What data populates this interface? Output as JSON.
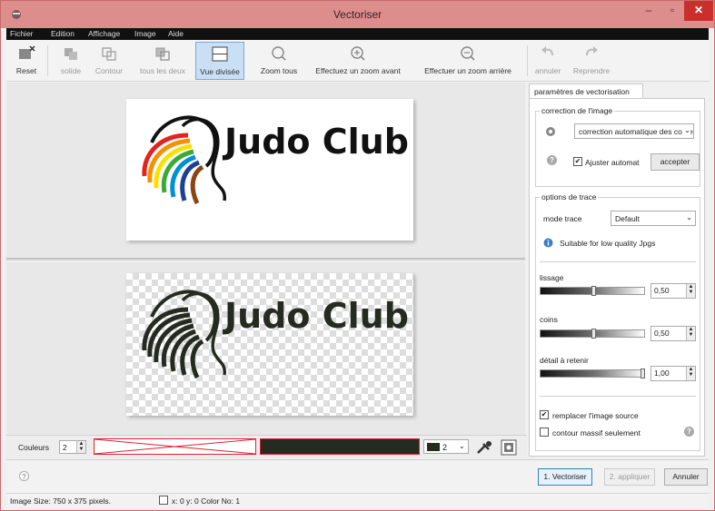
{
  "window": {
    "title": "Vectoriser",
    "min": "–",
    "max": "▫",
    "close": "✕"
  },
  "menu": [
    "Fichier",
    "Edition",
    "Affichage",
    "Image",
    "Aide"
  ],
  "toolbar": {
    "reset": "Reset",
    "solide": "solide",
    "contour": "Contour",
    "tous_les_deux": "tous les deux",
    "vue_divisee": "Vue divisée",
    "zoom_tous": "Zoom tous",
    "zoom_avant": "Effectuez un zoom avant",
    "zoom_arriere": "Effectuer un zoom arrière",
    "annuler": "annuler",
    "reprendre": "Reprendre"
  },
  "canvas": {
    "logo_text": "Judo Club"
  },
  "colorbar": {
    "label": "Couleurs",
    "count": "2",
    "palette_value": "2"
  },
  "panel": {
    "tab": "paramètres de vectorisation",
    "correction": {
      "caption": "correction de l'image",
      "select": "correction automatique des couleurs",
      "ajuster_label": "Ajuster automat",
      "ajuster_checked": true,
      "accepter": "accepter"
    },
    "trace": {
      "caption": "options de trace",
      "mode_label": "mode trace",
      "mode_value": "Default",
      "info": "Suitable for low quality Jpgs",
      "lissage_label": "lissage",
      "lissage_value": "0,50",
      "coins_label": "coins",
      "coins_value": "0,50",
      "detail_label": "détail à retenir",
      "detail_value": "1,00",
      "remplacer_label": "remplacer l'image source",
      "remplacer_checked": true,
      "contour_massif_label": "contour massif seulement",
      "contour_massif_checked": false
    }
  },
  "buttons": {
    "vectoriser": "1. Vectoriser",
    "appliquer": "2. appliquer",
    "annuler": "Annuler"
  },
  "status": {
    "size": "Image Size: 750 x 375 pixels.",
    "coords": "x: 0 y: 0  Color No: 1"
  },
  "colors": {
    "titlebar": "#de8d8d",
    "close": "#c9302c",
    "dark": "#262b22",
    "accent": "#3c7fb1"
  }
}
